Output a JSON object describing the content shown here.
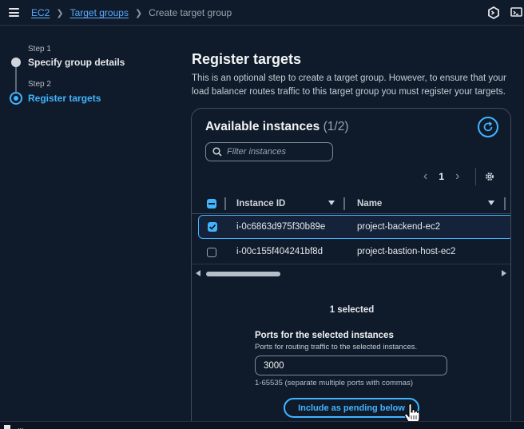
{
  "breadcrumb": {
    "items": [
      "EC2",
      "Target groups"
    ],
    "current": "Create target group"
  },
  "steps": [
    {
      "number": "Step 1",
      "title": "Specify group details"
    },
    {
      "number": "Step 2",
      "title": "Register targets"
    }
  ],
  "page": {
    "title": "Register targets",
    "description": "This is an optional step to create a target group. However, to ensure that your load balancer routes traffic to this target group you must register your targets."
  },
  "instances": {
    "title": "Available instances",
    "count": "(1/2)",
    "filter_placeholder": "Filter instances",
    "page_number": "1",
    "columns": [
      "Instance ID",
      "Name"
    ],
    "rows": [
      {
        "id": "i-0c6863d975f30b89e",
        "name": "project-backend-ec2",
        "selected": true
      },
      {
        "id": "i-00c155f404241bf8d",
        "name": "project-bastion-host-ec2",
        "selected": false
      }
    ],
    "selected_text": "1 selected"
  },
  "ports": {
    "label": "Ports for the selected instances",
    "description": "Ports for routing traffic to the selected instances.",
    "value": "3000",
    "hint": "1-65535 (separate multiple ports with commas)"
  },
  "include_button_label": "Include as pending below",
  "bottom": {
    "text": "..."
  },
  "colors": {
    "accent": "#42b4ff",
    "background": "#0f1b2a",
    "border": "#414d5c"
  },
  "icons": [
    "menu-icon",
    "chevron-right-icon",
    "cloudshell-icon",
    "feedback-icon",
    "refresh-icon",
    "search-icon",
    "gear-icon",
    "sort-down-icon",
    "hand-cursor-icon"
  ]
}
